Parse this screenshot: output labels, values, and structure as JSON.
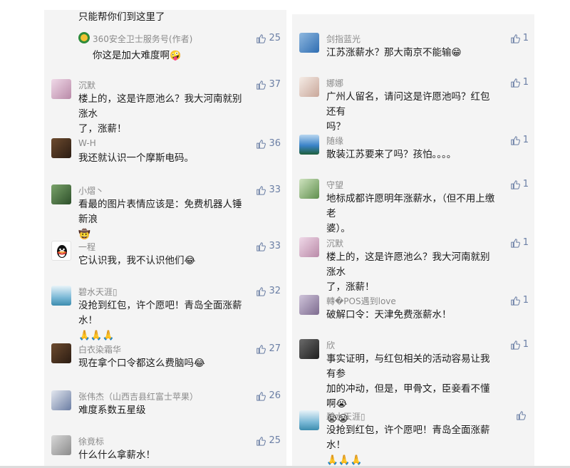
{
  "left": {
    "cut_text": "只能帮你们到这里了",
    "reply": {
      "name": "360安全卫士服务号(作者)",
      "text": "你这是加大难度啊",
      "emoji": "🤪",
      "likes": "25"
    },
    "comments": [
      {
        "name": "沉默",
        "avatar": "av-pink",
        "lines": [
          "楼上的，这是许愿池么？我大河南就别涨水",
          "了，涨薪！"
        ],
        "likes": "37"
      },
      {
        "name": "W-H",
        "avatar": "av-face",
        "lines": [
          "我还就认识一个摩斯电码。"
        ],
        "likes": "36"
      },
      {
        "name": "小熠丶",
        "avatar": "av-moss",
        "lines": [
          "看最的图片表情应该是：免费机器人锤新浪",
          "🤠"
        ],
        "likes": "33"
      },
      {
        "name": "一程",
        "avatar": "av-qq",
        "lines": [
          "它认识我，我不认识他们😂"
        ],
        "likes": "33"
      },
      {
        "name": "碧水天涯▯",
        "avatar": "av-water",
        "lines": [
          "没抢到红包，许个愿吧！青岛全面涨薪水！",
          "🙏🙏🙏"
        ],
        "likes": "32"
      },
      {
        "name": "白衣染霜华",
        "avatar": "av-face",
        "lines": [
          "现在拿个口令都这么费脑吗😂"
        ],
        "likes": "27"
      },
      {
        "name": "张伟杰（山西吉县红富士苹果）",
        "avatar": "av-boy",
        "lines": [
          "难度系数五星级"
        ],
        "likes": "26"
      },
      {
        "name": "徐竟标",
        "avatar": "av-grey",
        "lines": [
          "什么什么拿薪水！"
        ],
        "likes": "25"
      }
    ]
  },
  "right": {
    "comments": [
      {
        "name": "剑指蓝光",
        "avatar": "av-sky",
        "lines": [
          "江苏涨薪水？那大南京不能输😁"
        ],
        "likes": "1"
      },
      {
        "name": "娜娜",
        "avatar": "av-girl",
        "lines": [
          "广州人留名，请问这是许愿池吗？红包还有",
          "吗？"
        ],
        "likes": "1"
      },
      {
        "name": "随缘",
        "avatar": "av-lake",
        "lines": [
          "散装江苏要来了吗？孩怕。。。。"
        ],
        "likes": "1"
      },
      {
        "name": "守望",
        "avatar": "av-green",
        "lines": [
          "地标成都许愿明年涨薪水，（但不用上缴老",
          "婆）。"
        ],
        "likes": "1"
      },
      {
        "name": "沉默",
        "avatar": "av-pink",
        "lines": [
          "楼上的，这是许愿池么？我大河南就别涨水",
          "了，涨薪！"
        ],
        "likes": "1"
      },
      {
        "name": "轉�POS遇到love",
        "avatar": "av-purple",
        "lines": [
          "破解口令：天津免费涨薪水！"
        ],
        "likes": "1"
      },
      {
        "name": "欣",
        "avatar": "av-dark",
        "lines": [
          "事实证明，与红包相关的活动容易让我有参",
          "加的冲动，但是，甲骨文，臣妾看不懂啊😭",
          "😭😭"
        ],
        "likes": "1"
      },
      {
        "name": "碧水天涯▯",
        "avatar": "av-water",
        "lines": [
          "没抢到红包，许个愿吧！青岛全面涨薪水！",
          "🙏🙏🙏"
        ],
        "likes": ""
      }
    ]
  },
  "colors": {
    "panel": "#f4f4f4",
    "like": "#6b7fa5",
    "name": "#8a8a8a",
    "text": "#1a1a1a"
  },
  "icons": {
    "like": "thumbs-up-icon",
    "reply": "360-logo-icon"
  }
}
